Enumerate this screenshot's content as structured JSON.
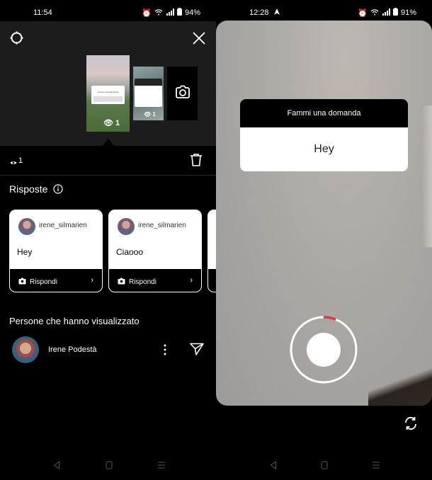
{
  "left": {
    "status": {
      "time": "11:54",
      "battery": "94%"
    },
    "header": {
      "settings_icon": "gear-icon",
      "close_icon": "close-icon"
    },
    "thumbnails": [
      {
        "question": "Fammi una domanda",
        "views": "1"
      },
      {
        "views": "1"
      },
      {
        "icon": "camera-icon"
      }
    ],
    "view_count": "1",
    "responses": {
      "title": "Risposte",
      "cards": [
        {
          "username": "irene_silmarien",
          "message": "Hey",
          "reply_label": "Rispondi"
        },
        {
          "username": "irene_silmarien",
          "message": "Ciaooo",
          "reply_label": "Rispondi"
        }
      ]
    },
    "viewers": {
      "title": "Persone che hanno visualizzato",
      "list": [
        {
          "name": "Irene Podestà"
        }
      ]
    }
  },
  "right": {
    "status": {
      "time": "12:28",
      "battery": "91%"
    },
    "question_sticker": {
      "title": "Fammi una domanda",
      "answer": "Hey"
    },
    "record_progress": 0.06,
    "colors": {
      "progress": "#e0364b"
    }
  }
}
